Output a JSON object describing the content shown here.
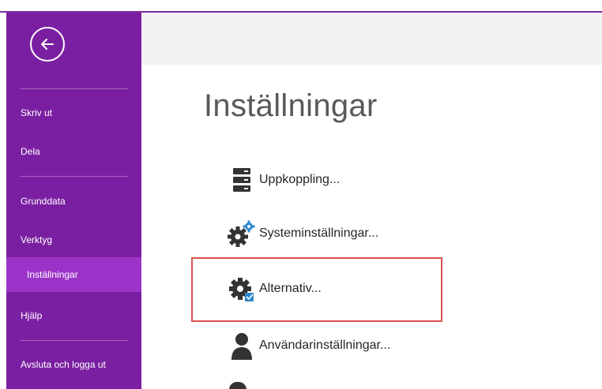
{
  "page": {
    "title": "Inställningar"
  },
  "colors": {
    "sidebar_bg": "#7b1fa2",
    "sidebar_active_bg": "#9c33c8",
    "highlight_border": "#d9534f",
    "header_band": "#f2f2f2"
  },
  "sidebar": {
    "back_icon": "arrow-left-circle-icon",
    "items": [
      {
        "label": "Skriv ut"
      },
      {
        "label": "Dela"
      },
      {
        "label": "Grunddata"
      },
      {
        "label": "Verktyg"
      },
      {
        "label": "Inställningar",
        "active": true
      },
      {
        "label": "Hjälp"
      },
      {
        "label": "Avsluta och logga ut"
      }
    ]
  },
  "options": [
    {
      "label": "Uppkoppling...",
      "icon": "server-icon"
    },
    {
      "label": "Systeminställningar...",
      "icon": "gears-icon"
    },
    {
      "label": "Alternativ...",
      "icon": "gear-check-icon",
      "highlighted": true
    },
    {
      "label": "Användarinställningar...",
      "icon": "user-icon"
    }
  ]
}
